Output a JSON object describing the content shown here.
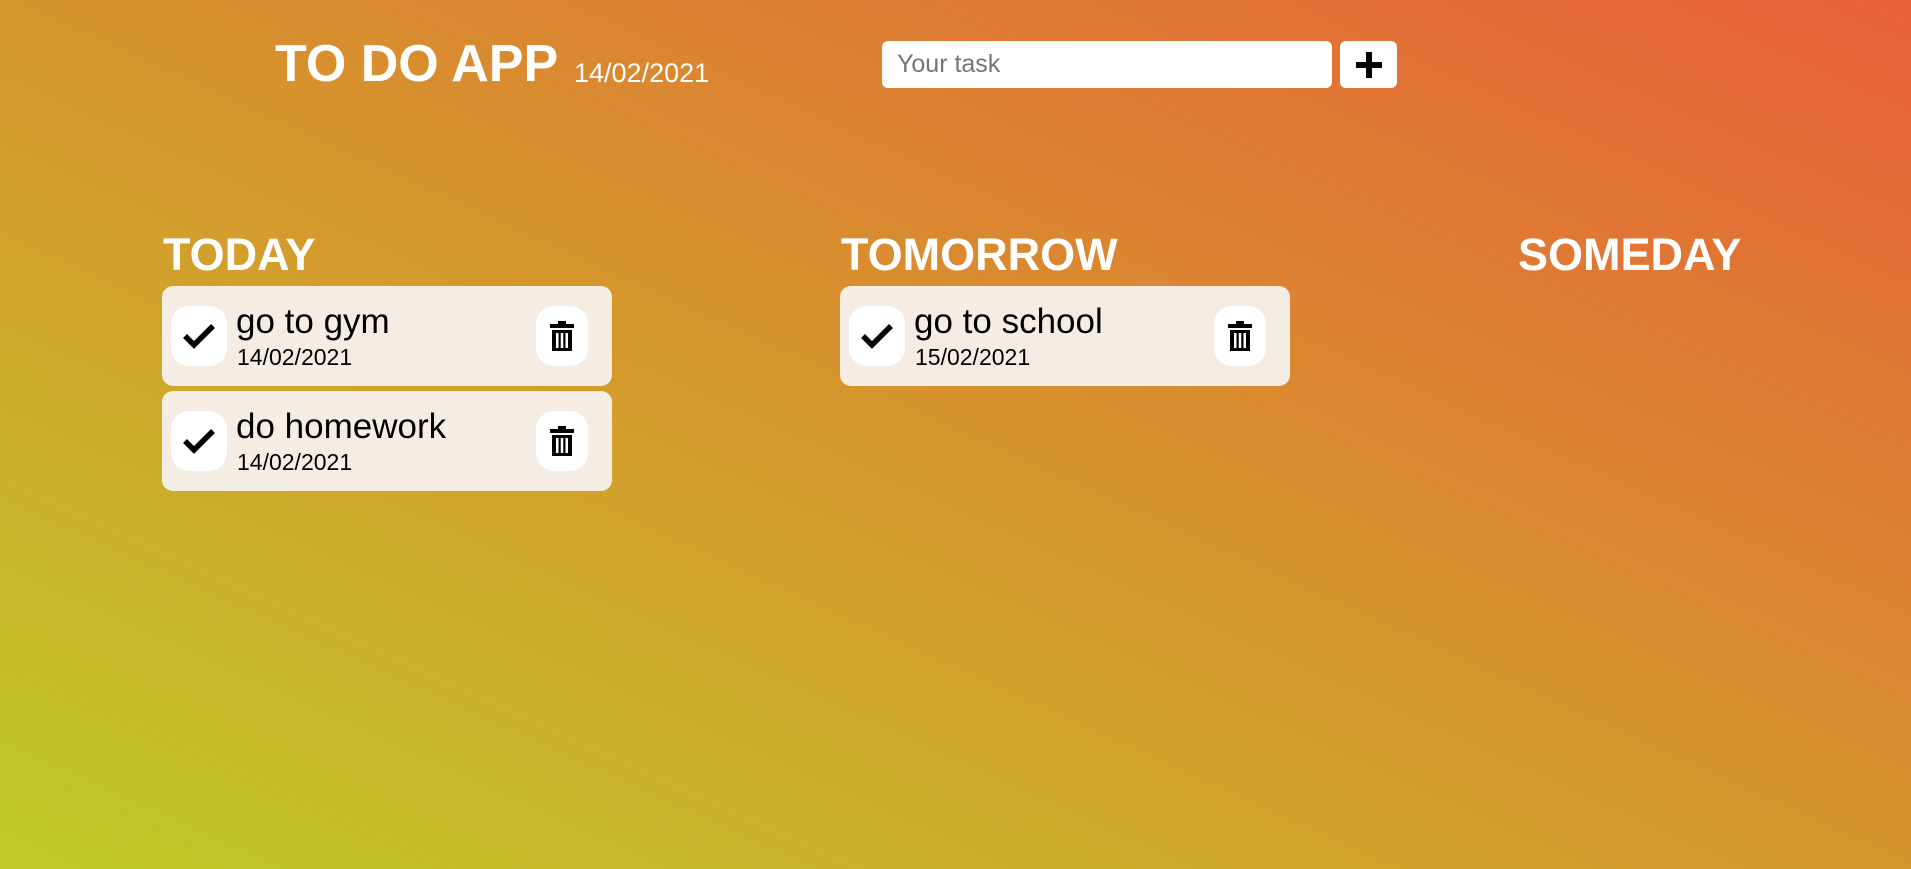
{
  "header": {
    "title": "TO DO APP",
    "date": "14/02/2021"
  },
  "new_task": {
    "placeholder": "Your task",
    "value": "",
    "add_icon": "plus-icon"
  },
  "columns": [
    {
      "title": "TODAY",
      "tasks": [
        {
          "title": "go to gym",
          "date": "14/02/2021"
        },
        {
          "title": "do homework",
          "date": "14/02/2021"
        }
      ]
    },
    {
      "title": "TOMORROW",
      "tasks": [
        {
          "title": "go to school",
          "date": "15/02/2021"
        }
      ]
    },
    {
      "title": "SOMEDAY",
      "tasks": []
    }
  ],
  "icons": {
    "complete": "check-icon",
    "delete": "trash-icon"
  },
  "colors": {
    "gradient_start": "#bfc928",
    "gradient_mid": "#d49a2c",
    "gradient_end": "#e8603a",
    "card_background": "#f5ede3",
    "heading_text": "#ffffff"
  }
}
